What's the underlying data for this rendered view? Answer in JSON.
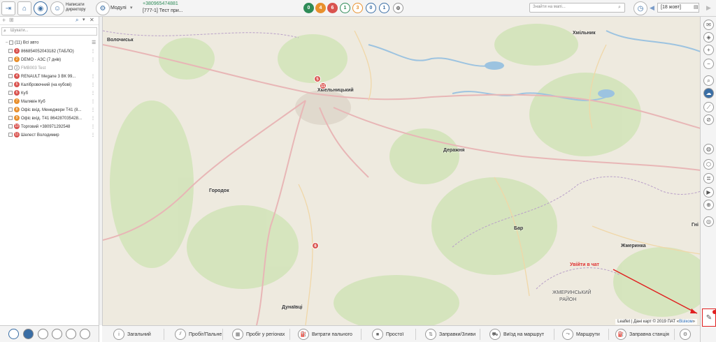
{
  "header": {
    "write_director_label": "Написати директору",
    "modules_label": "Модулі",
    "phone": "+380965474881",
    "object_label": "[777-1] Тест при...",
    "status_badges": [
      {
        "value": "0",
        "color": "#2e8b57"
      },
      {
        "value": "4",
        "color": "#e8902d"
      },
      {
        "value": "6",
        "color": "#d9534f"
      },
      {
        "value": "1",
        "color": "#ffffff"
      },
      {
        "value": "3",
        "color": "#ffffff"
      },
      {
        "value": "0",
        "color": "#ffffff"
      },
      {
        "value": "1",
        "color": "#ffffff"
      }
    ],
    "map_search_placeholder": "Знайти на мапі...",
    "date_value": "[18 жовт]"
  },
  "sidebar": {
    "search_placeholder": "Шукати...",
    "root_label": "(11) Всі авто",
    "items": [
      {
        "num": "1",
        "label": "866854052043182 (ТАБЛО)",
        "status": "red"
      },
      {
        "num": "2",
        "label": "DEMO - АЗС (7 днів)",
        "status": "orange"
      },
      {
        "num": "3",
        "label": "FMB003 Test",
        "status": "gray"
      },
      {
        "num": "4",
        "label": "RENAULT Megane 3 ВК 99...",
        "status": "red"
      },
      {
        "num": "5",
        "label": "Калібровочний (на кубові)",
        "status": "red"
      },
      {
        "num": "6",
        "label": "Куб",
        "status": "red"
      },
      {
        "num": "7",
        "label": "Малявін Куб",
        "status": "orange"
      },
      {
        "num": "8",
        "label": "Офіс вхід. Менеджери Т41 (8...",
        "status": "orange"
      },
      {
        "num": "9",
        "label": "Офіс вхід. Т41 864287035428...",
        "status": "orange"
      },
      {
        "num": "10",
        "label": "Торговий +380971292548",
        "status": "red"
      },
      {
        "num": "11",
        "label": "Шелест Володимир",
        "status": "red"
      }
    ]
  },
  "map": {
    "cities": [
      {
        "name": "Волочиськ"
      },
      {
        "name": "Хмельницький"
      },
      {
        "name": "Хмільник"
      },
      {
        "name": "Деражня"
      },
      {
        "name": "Городок"
      },
      {
        "name": "Бар"
      },
      {
        "name": "Жмеринка"
      },
      {
        "name": "ЖМЕРИНСЬКИЙ"
      },
      {
        "name": "РАЙОН"
      },
      {
        "name": "Дунаївці"
      },
      {
        "name": "Гні"
      }
    ],
    "markers": [
      "5",
      "11",
      "6"
    ],
    "attribution_prefix": "Leaflet | Дані карт © 2019 ПАТ «",
    "attribution_link": "Візіком",
    "attribution_suffix": "»",
    "chat_hint": "Увійти в чат"
  },
  "bottom_tabs": [
    {
      "label": "Загальний",
      "icon": "info-icon"
    },
    {
      "label": "Пробіг/Пальне",
      "icon": "road-icon"
    },
    {
      "label": "Пробіг у регіонах",
      "icon": "region-icon"
    },
    {
      "label": "Витрати пального",
      "icon": "fuel-icon"
    },
    {
      "label": "Простої",
      "icon": "stop-icon"
    },
    {
      "label": "Заправки/Зливи",
      "icon": "refuel-icon"
    },
    {
      "label": "Виїзд на маршрут",
      "icon": "truck-icon"
    },
    {
      "label": "Маршрути",
      "icon": "route-icon"
    },
    {
      "label": "Заправна станція",
      "icon": "gas-station-icon"
    }
  ],
  "colors": {
    "accent": "#3a6ea5",
    "alert": "#d9534f",
    "chat_red": "#e02020"
  }
}
